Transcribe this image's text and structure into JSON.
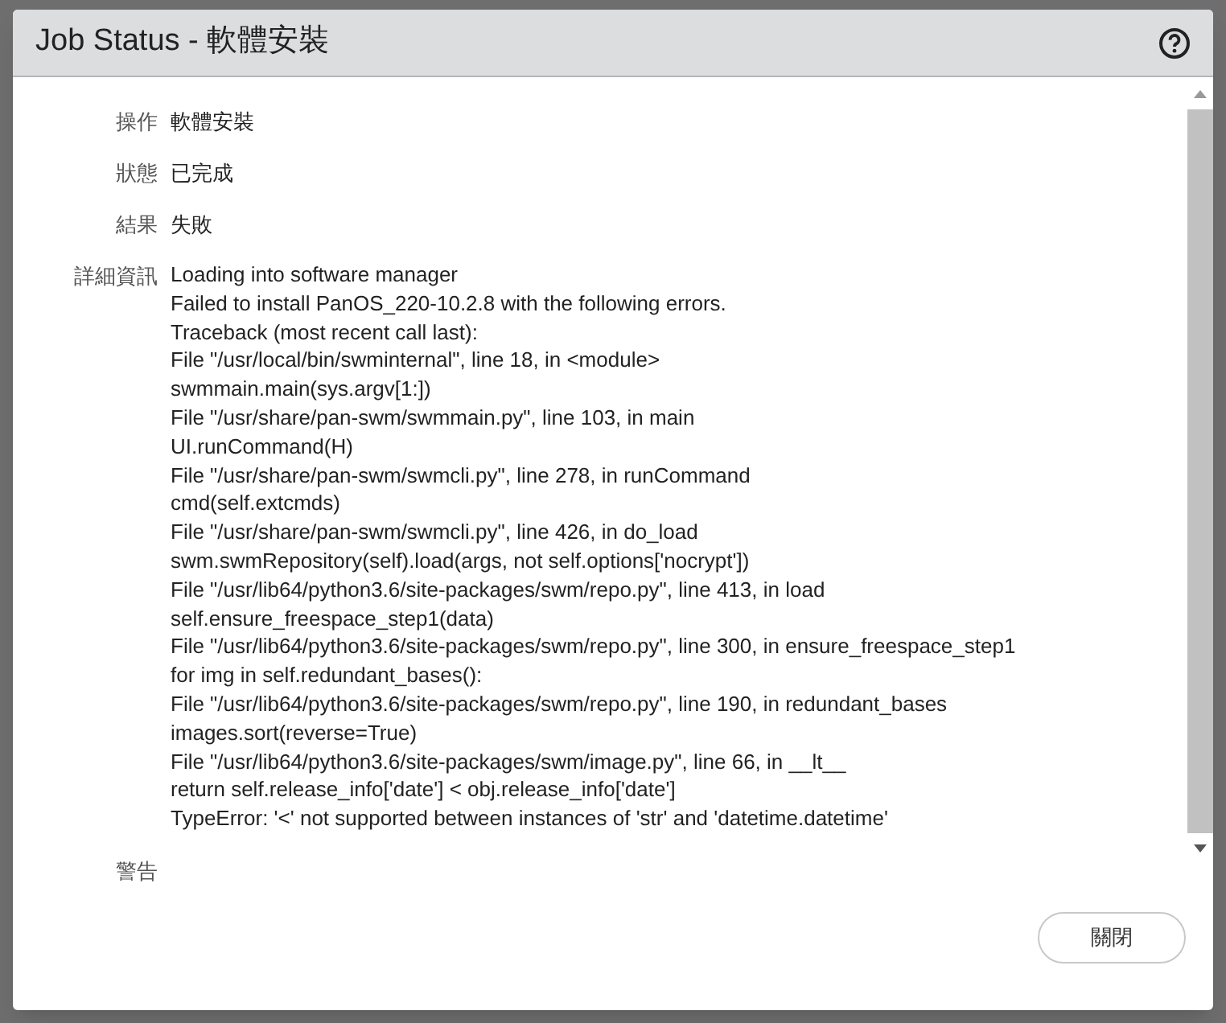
{
  "dialog": {
    "title": "Job Status - 軟體安裝",
    "fields": [
      {
        "label": "操作",
        "value": "軟體安裝"
      },
      {
        "label": "狀態",
        "value": "已完成"
      },
      {
        "label": "結果",
        "value": "失敗"
      }
    ],
    "details": {
      "label": "詳細資訊",
      "lines": [
        "Loading into software manager",
        "Failed to install PanOS_220-10.2.8 with the following errors.",
        "Traceback (most recent call last):",
        "File \"/usr/local/bin/swminternal\", line 18, in <module>",
        "swmmain.main(sys.argv[1:])",
        "File \"/usr/share/pan-swm/swmmain.py\", line 103, in main",
        "UI.runCommand(H)",
        "File \"/usr/share/pan-swm/swmcli.py\", line 278, in runCommand",
        "cmd(self.extcmds)",
        "File \"/usr/share/pan-swm/swmcli.py\", line 426, in do_load",
        "swm.swmRepository(self).load(args, not self.options['nocrypt'])",
        "File \"/usr/lib64/python3.6/site-packages/swm/repo.py\", line 413, in load",
        "self.ensure_freespace_step1(data)",
        "File \"/usr/lib64/python3.6/site-packages/swm/repo.py\", line 300, in ensure_freespace_step1",
        "for img in self.redundant_bases():",
        "File \"/usr/lib64/python3.6/site-packages/swm/repo.py\", line 190, in redundant_bases",
        "images.sort(reverse=True)",
        "File \"/usr/lib64/python3.6/site-packages/swm/image.py\", line 66, in __lt__",
        "return self.release_info['date'] < obj.release_info['date']",
        "TypeError: '<' not supported between instances of 'str' and 'datetime.datetime'"
      ]
    },
    "warning": {
      "label": "警告"
    },
    "buttons": [
      "關閉"
    ]
  }
}
